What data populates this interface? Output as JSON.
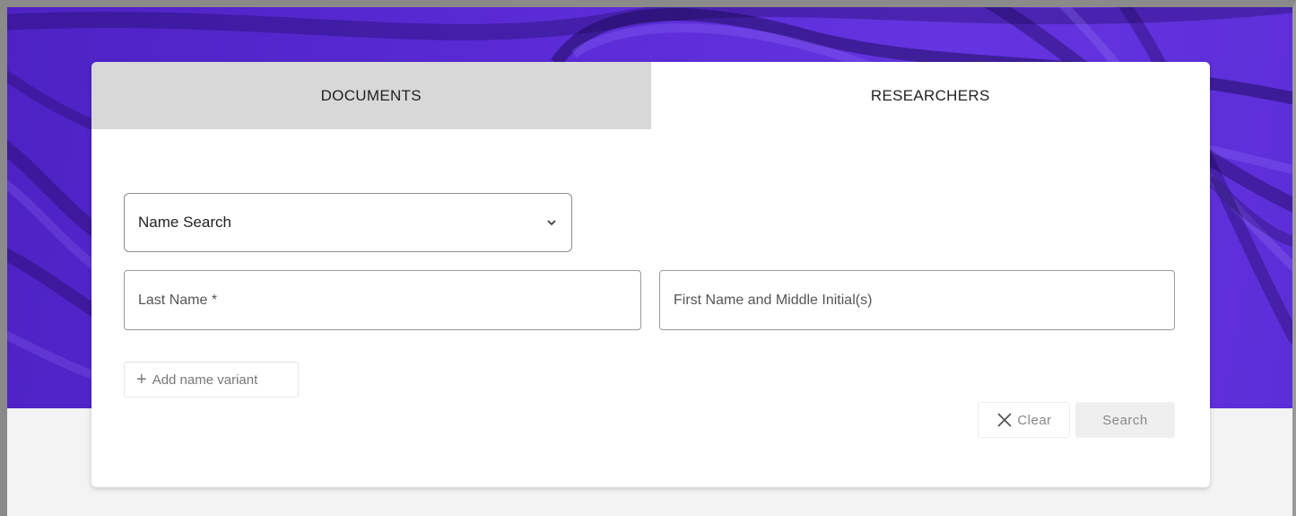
{
  "tabs": [
    {
      "label": "DOCUMENTS",
      "active": false
    },
    {
      "label": "RESEARCHERS",
      "active": true
    }
  ],
  "search_type": {
    "selected": "Name Search",
    "icon": "chevron-down-icon"
  },
  "fields": {
    "last_name": {
      "placeholder": "Last Name *",
      "value": ""
    },
    "first_name": {
      "placeholder": "First Name and Middle Initial(s)",
      "value": ""
    }
  },
  "actions": {
    "add_variant": {
      "icon": "plus-icon",
      "label": "Add name variant"
    },
    "clear": {
      "icon": "close-icon",
      "label": "Clear"
    },
    "search": {
      "label": "Search"
    }
  },
  "colors": {
    "hero": "#5a2bd6",
    "tab_inactive": "#d8d8d8",
    "card": "#ffffff",
    "page_background": "#f3f3f3"
  }
}
